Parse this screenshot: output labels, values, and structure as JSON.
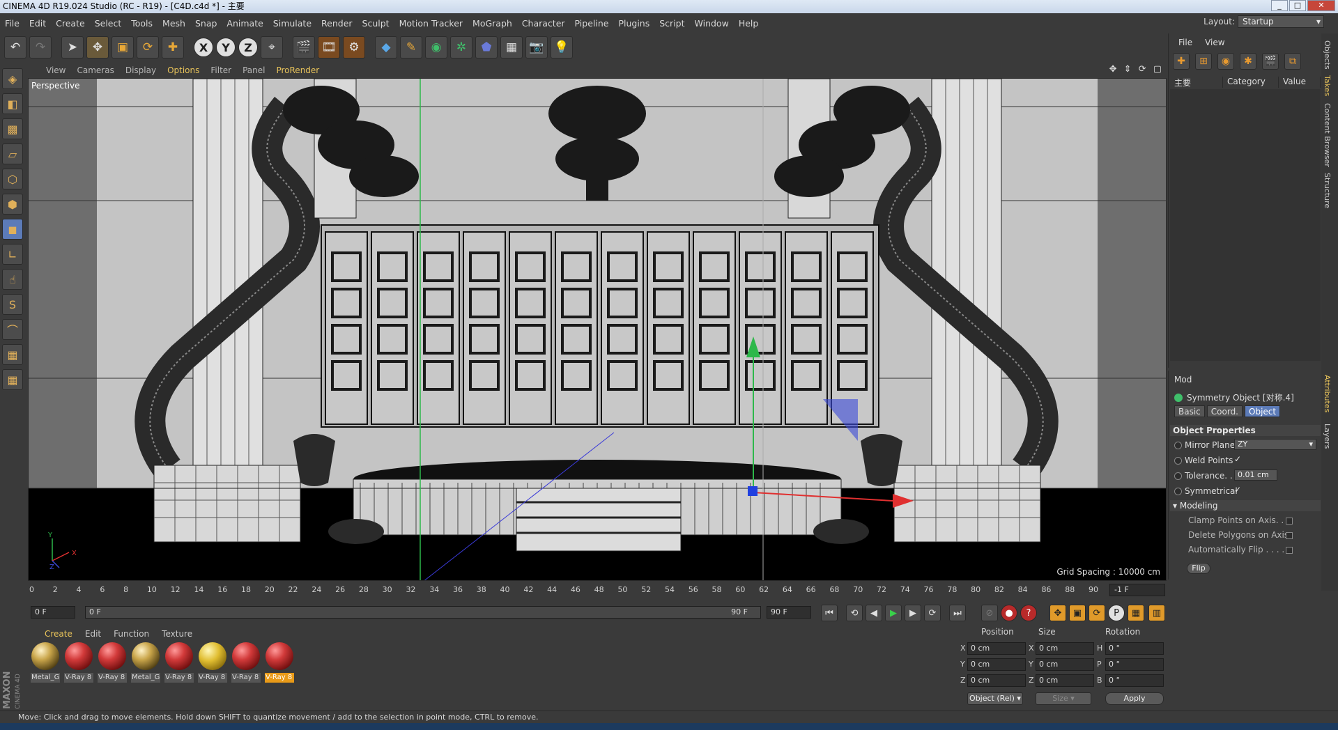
{
  "window": {
    "title": "CINEMA 4D R19.024 Studio (RC - R19) - [C4D.c4d *] - 主要",
    "controls": [
      "_",
      "□",
      "✕"
    ]
  },
  "menu": [
    "File",
    "Edit",
    "Create",
    "Select",
    "Tools",
    "Mesh",
    "Snap",
    "Animate",
    "Simulate",
    "Render",
    "Sculpt",
    "Motion Tracker",
    "MoGraph",
    "Character",
    "Pipeline",
    "Plugins",
    "Script",
    "Window",
    "Help"
  ],
  "layout": {
    "label": "Layout:",
    "value": "Startup"
  },
  "viewport": {
    "menu": [
      "View",
      "Cameras",
      "Display",
      "Options",
      "Filter",
      "Panel",
      "ProRender"
    ],
    "highlighted_menu": [
      "Options",
      "ProRender"
    ],
    "camera_label": "Perspective",
    "grid_spacing": "Grid Spacing : 10000 cm",
    "axis": {
      "y": "Y",
      "z": "Z",
      "x": "X"
    }
  },
  "timeline": {
    "ruler_ticks": [
      "0",
      "2",
      "4",
      "6",
      "8",
      "10",
      "12",
      "14",
      "16",
      "18",
      "20",
      "22",
      "24",
      "26",
      "28",
      "30",
      "32",
      "34",
      "36",
      "38",
      "40",
      "42",
      "44",
      "46",
      "48",
      "50",
      "52",
      "54",
      "56",
      "58",
      "60",
      "62",
      "64",
      "66",
      "68",
      "70",
      "72",
      "74",
      "76",
      "78",
      "80",
      "82",
      "84",
      "86",
      "88",
      "90"
    ],
    "frame_end_display": "-1 F",
    "start_frame": "0 F",
    "range_start": "0 F",
    "range_end": "90 F",
    "end_frame": "90 F"
  },
  "materials": {
    "menu": [
      "Create",
      "Edit",
      "Function",
      "Texture"
    ],
    "items": [
      {
        "label": "Metal_G",
        "kind": "gold"
      },
      {
        "label": "V-Ray 8",
        "kind": "red"
      },
      {
        "label": "V-Ray 8",
        "kind": "red"
      },
      {
        "label": "Metal_G",
        "kind": "gold"
      },
      {
        "label": "V-Ray 8",
        "kind": "red"
      },
      {
        "label": "V-Ray 8",
        "kind": "yellow"
      },
      {
        "label": "V-Ray 8",
        "kind": "red"
      },
      {
        "label": "V-Ray 8",
        "kind": "red",
        "selected": true
      }
    ]
  },
  "coordinates": {
    "headers": [
      "Position",
      "Size",
      "Rotation"
    ],
    "rows": [
      {
        "axis": "X",
        "pos": "0 cm",
        "size_axis": "X",
        "size": "0 cm",
        "rot_axis": "H",
        "rot": "0 °"
      },
      {
        "axis": "Y",
        "pos": "0 cm",
        "size_axis": "Y",
        "size": "0 cm",
        "rot_axis": "P",
        "rot": "0 °"
      },
      {
        "axis": "Z",
        "pos": "0 cm",
        "size_axis": "Z",
        "size": "0 cm",
        "rot_axis": "B",
        "rot": "0 °"
      }
    ],
    "mode": "Object (Rel)",
    "size_mode": "Size",
    "apply": "Apply"
  },
  "status": "Move: Click and drag to move elements. Hold down SHIFT to quantize movement / add to the selection in point mode, CTRL to remove.",
  "objects_panel": {
    "menu": [
      "File",
      "View"
    ],
    "columns": [
      "主要",
      "Category",
      "Value"
    ]
  },
  "attributes": {
    "mode": "Mod",
    "object": "Symmetry Object [对称.4]",
    "tabs": [
      "Basic",
      "Coord.",
      "Object"
    ],
    "active_tab": "Object",
    "section": "Object Properties",
    "mirror_plane_label": "Mirror Plane",
    "mirror_plane": "ZY",
    "weld_points_label": "Weld Points",
    "weld_points": "✓",
    "tolerance_label": "Tolerance. . .",
    "tolerance": "0.01 cm",
    "symmetrical_label": "Symmetrical",
    "symmetrical": "✓",
    "modeling_section": "Modeling",
    "clamp_label": "Clamp Points on Axis. . .",
    "delete_label": "Delete Polygons on Axis",
    "autoflip_label": "Automatically Flip . . . . .",
    "flip_button": "Flip"
  },
  "side_tabs": [
    "Objects",
    "Takes",
    "Content Browser",
    "Structure",
    "Attributes",
    "Layers"
  ],
  "logo": "MAXON CINEMA 4D"
}
